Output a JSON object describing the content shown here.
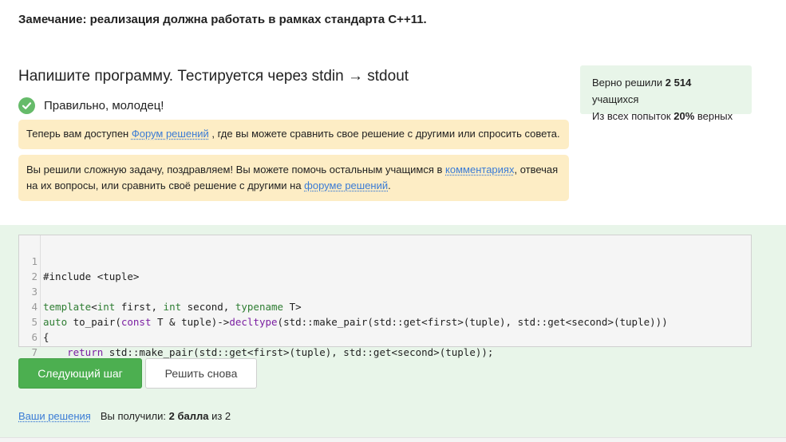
{
  "note": "Замечание: реализация должна работать в рамках стандарта C++11.",
  "task": {
    "title": "Напишите программу. Тестируется через stdin → stdout"
  },
  "stats": {
    "line1_prefix": "Верно решили ",
    "solved_count": "2 514",
    "line1_suffix": " учащихся",
    "line2_prefix": "Из всех попыток ",
    "success_rate": "20%",
    "line2_suffix": " верных"
  },
  "result": {
    "message": "Правильно, молодец!"
  },
  "hint1": {
    "prefix": "Теперь вам доступен ",
    "link": "Форум решений",
    "suffix": " , где вы можете сравнить свое решение с другими или спросить совета."
  },
  "hint2": {
    "part1": "Вы решили сложную задачу, поздравляем! Вы можете помочь остальным учащимся в ",
    "link1": "комментариях",
    "part2": ", отвечая на их вопросы, или сравнить своё решение с другими на ",
    "link2": "форуме решений",
    "part3": "."
  },
  "code": {
    "line_numbers": [
      "1",
      "2",
      "3",
      "4",
      "5",
      "6",
      "7"
    ],
    "l1": "#include <tuple>",
    "l3_kw1": "template",
    "l3_a": "<",
    "l3_kw2": "int",
    "l3_b": " first, ",
    "l3_kw3": "int",
    "l3_c": " second, ",
    "l3_kw4": "typename",
    "l3_d": " T>",
    "l4_kw1": "auto",
    "l4_a": " to_pair(",
    "l4_kw2": "const",
    "l4_b": " T & tuple)->",
    "l4_kw3": "decltype",
    "l4_c": "(std::make_pair(std::get<first>(tuple), std::get<second>(tuple)))",
    "l5": "{",
    "l6_indent": "    ",
    "l6_kw": "return",
    "l6_rest": " std::make_pair(std::get<first>(tuple), std::get<second>(tuple));",
    "l7": "}"
  },
  "buttons": {
    "next": "Следующий шаг",
    "retry": "Решить снова"
  },
  "footer": {
    "your_solutions": "Ваши решения",
    "score_prefix": "Вы получили: ",
    "score": "2 балла",
    "score_suffix": " из 2"
  },
  "colors": {
    "accent_green": "#4caf50",
    "hint_bg": "#fdedc5",
    "success_bg": "#e8f5e9",
    "link": "#3a7bd5"
  }
}
